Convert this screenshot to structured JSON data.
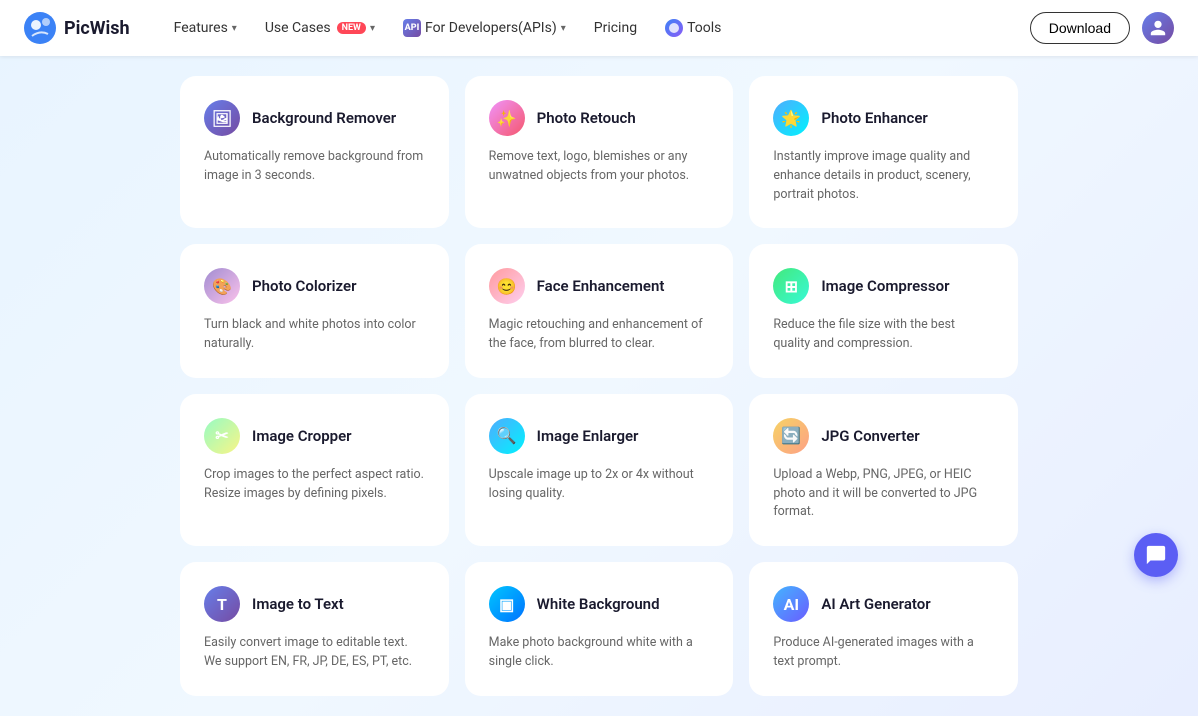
{
  "navbar": {
    "logo_text": "PicWish",
    "nav_items": [
      {
        "label": "Features",
        "has_chevron": true,
        "badge": null,
        "icon": null
      },
      {
        "label": "Use Cases",
        "has_chevron": true,
        "badge": "NEW",
        "icon": null
      },
      {
        "label": "For Developers(APIs)",
        "has_chevron": true,
        "badge": null,
        "icon": "api"
      },
      {
        "label": "Pricing",
        "has_chevron": false,
        "badge": null,
        "icon": null
      },
      {
        "label": "Tools",
        "has_chevron": false,
        "badge": null,
        "icon": "ai"
      }
    ],
    "download_label": "Download"
  },
  "cards": [
    {
      "id": "background-remover",
      "title": "Background Remover",
      "desc": "Automatically remove background from image in 3 seconds.",
      "icon": "🖼️",
      "icon_class": "icon-blue"
    },
    {
      "id": "photo-retouch",
      "title": "Photo Retouch",
      "desc": "Remove text, logo, blemishes or any unwatned objects from your photos.",
      "icon": "✨",
      "icon_class": "icon-orange"
    },
    {
      "id": "photo-enhancer",
      "title": "Photo Enhancer",
      "desc": "Instantly improve image quality and enhance details in product, scenery, portrait photos.",
      "icon": "🌟",
      "icon_class": "icon-green"
    },
    {
      "id": "photo-colorizer",
      "title": "Photo Colorizer",
      "desc": "Turn black and white photos into color naturally.",
      "icon": "🎨",
      "icon_class": "icon-purple"
    },
    {
      "id": "face-enhancement",
      "title": "Face Enhancement",
      "desc": "Magic retouching and enhancement of the face, from blurred to clear.",
      "icon": "😊",
      "icon_class": "icon-pink"
    },
    {
      "id": "image-compressor",
      "title": "Image Compressor",
      "desc": "Reduce the file size with the best quality and compression.",
      "icon": "📦",
      "icon_class": "icon-teal"
    },
    {
      "id": "image-cropper",
      "title": "Image Cropper",
      "desc": "Crop images to the perfect aspect ratio. Resize images by defining pixels.",
      "icon": "✂️",
      "icon_class": "icon-lime"
    },
    {
      "id": "image-enlarger",
      "title": "Image Enlarger",
      "desc": "Upscale image up to 2x or 4x without losing quality.",
      "icon": "🔍",
      "icon_class": "icon-cyan"
    },
    {
      "id": "jpg-converter",
      "title": "JPG Converter",
      "desc": "Upload a Webp, PNG, JPEG, or HEIC photo and it will be converted to JPG format.",
      "icon": "🔄",
      "icon_class": "icon-amber"
    },
    {
      "id": "image-to-text",
      "title": "Image to Text",
      "desc": "Easily convert image to editable text. We support EN, FR, JP, DE, ES, PT, etc.",
      "icon": "📝",
      "icon_class": "icon-indigo"
    },
    {
      "id": "white-background",
      "title": "White Background",
      "desc": "Make photo background white with a single click.",
      "icon": "⬜",
      "icon_class": "icon-skyblue"
    },
    {
      "id": "ai-art-generator",
      "title": "AI Art Generator",
      "desc": "Produce AI-generated images with a text prompt.",
      "icon": "🤖",
      "icon_class": "icon-aiblue"
    }
  ]
}
